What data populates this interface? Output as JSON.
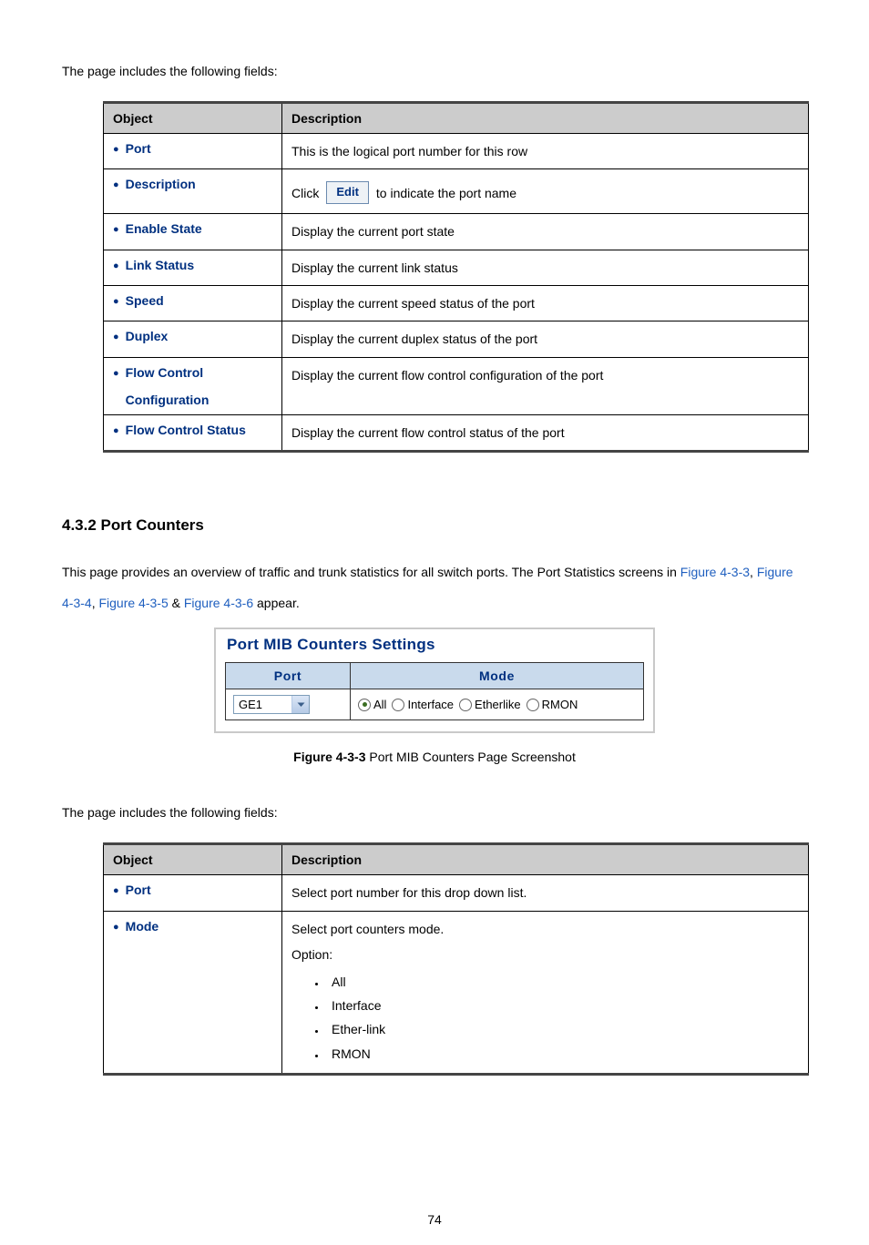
{
  "intro1": "The page includes the following fields:",
  "table1": {
    "head_obj": "Object",
    "head_desc": "Description",
    "rows": {
      "port": {
        "label": "Port",
        "desc": "This is the logical port number for this row"
      },
      "description": {
        "label": "Description",
        "click": "Click",
        "btn": "Edit",
        "after": "to indicate the port name"
      },
      "enable": {
        "label": "Enable State",
        "desc": "Display the current port state"
      },
      "link": {
        "label": "Link Status",
        "desc": "Display the current link status"
      },
      "speed": {
        "label": "Speed",
        "desc": "Display the current speed status of the port"
      },
      "duplex": {
        "label": "Duplex",
        "desc": "Display the current duplex status of the port"
      },
      "flowcfg": {
        "label": "Flow Control",
        "label2": "Configuration",
        "desc": "Display the current flow control configuration of the port"
      },
      "flowstat": {
        "label": "Flow Control Status",
        "desc": "Display the current flow control status of the port"
      }
    }
  },
  "section_heading": "4.3.2 Port Counters",
  "section_para_a": "This page provides an overview of traffic and trunk statistics for all switch ports. The Port Statistics screens in ",
  "link_433": "Figure 4-3-3",
  "comma_sep": ", ",
  "link_434": "Figure 4-3-4",
  "comma_sep2": ", ",
  "link_435": "Figure 4-3-5",
  "amp": " & ",
  "link_436": "Figure 4-3-6",
  "appear": " appear.",
  "mib": {
    "title": "Port MIB Counters Settings",
    "head_port": "Port",
    "head_mode": "Mode",
    "select_value": "GE1",
    "radios": {
      "all": "All",
      "iface": "Interface",
      "eth": "Etherlike",
      "rmon": "RMON"
    }
  },
  "fig_caption_label": "Figure 4-3-3",
  "fig_caption_text": " Port MIB Counters Page Screenshot",
  "intro2": "The page includes the following fields:",
  "table2": {
    "head_obj": "Object",
    "head_desc": "Description",
    "rows": {
      "port": {
        "label": "Port",
        "desc": "Select port number for this drop down list."
      },
      "mode": {
        "label": "Mode",
        "line1": "Select port counters mode.",
        "line2": "Option:",
        "opts": {
          "all": "All",
          "iface": "Interface",
          "eth": "Ether-link",
          "rmon": "RMON"
        }
      }
    }
  },
  "page_num": "74"
}
